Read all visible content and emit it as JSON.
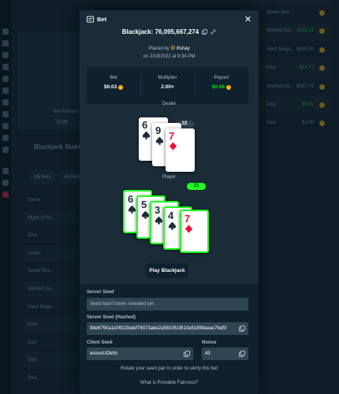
{
  "background": {
    "bet_amount_label": "Bet Amount",
    "bet_amount_value": "0.00",
    "game_title": "Blackjack  Stake Originals",
    "tabs": [
      "My Bets",
      "All Bets"
    ],
    "list_header": "Game",
    "list_rows": [
      "Might of Ra",
      "Dice",
      "Limbo",
      "Sweet Bon...",
      "Wanted De...",
      "Starz Mega...",
      "Dice",
      "Dice",
      "Dice",
      "Dice"
    ],
    "right_rows": [
      {
        "game": "Sweet Bon...",
        "amount": "",
        "green": false
      },
      {
        "game": "Wanted De...",
        "amount": "$131.11",
        "green": true
      },
      {
        "game": "Starz Mega...",
        "amount": "$400.00",
        "green": false
      },
      {
        "game": "Dice",
        "amount": "$14.77",
        "green": true
      },
      {
        "game": "Wanted De...",
        "amount": "$557.76",
        "green": false
      },
      {
        "game": "Dice",
        "amount": "$0.00",
        "green": true
      },
      {
        "game": "Dice",
        "amount": "$1.00",
        "green": false
      }
    ]
  },
  "modal": {
    "title": "Bet",
    "game_id": "Blackjack: 76,095,667,274",
    "placed_by_prefix": "Placed by",
    "username": "Bshay",
    "date": "on 2/19/2022 at 9:34 PM",
    "stats": [
      {
        "label": "Bet",
        "value": "$0.03",
        "coin": true,
        "green": false
      },
      {
        "label": "Multiplier",
        "value": "2.00×",
        "coin": false,
        "green": false
      },
      {
        "label": "Payout",
        "value": "$0.06",
        "coin": true,
        "green": true
      }
    ],
    "dealer": {
      "label": "Dealer",
      "score": "22",
      "cards": [
        {
          "rank": "6",
          "suit": "spade"
        },
        {
          "rank": "9",
          "suit": "spade"
        },
        {
          "rank": "7",
          "suit": "diamond"
        }
      ]
    },
    "player": {
      "label": "Player",
      "score": "21",
      "cards": [
        {
          "rank": "6",
          "suit": "spade"
        },
        {
          "rank": "5",
          "suit": "spade"
        },
        {
          "rank": "3",
          "suit": "spade"
        },
        {
          "rank": "4",
          "suit": "spade"
        },
        {
          "rank": "7",
          "suit": "diamond"
        }
      ]
    },
    "play_button": "Play Blackjack",
    "fairness": {
      "server_seed_label": "Server Seed",
      "server_seed_placeholder": "Seed hasn't been revealed yet",
      "server_seed_hashed_label": "Server Seed (Hashed)",
      "server_seed_hashed": "88e6750a1e091f2bdef76073abe2a581051f810a51899aeac7be5f",
      "client_seed_label": "Client Seed",
      "client_seed": "wssvsUOkhh",
      "nonce_label": "Nonce",
      "nonce": "43",
      "rotate_note": "Rotate your seed pair in order to verify this bet",
      "provable_link": "What is Provable Fairness?"
    }
  },
  "colors": {
    "modal_bg": "#1a2c38",
    "panel_bg": "#0f212e",
    "win_green": "#1fff20",
    "payout_green": "#00e701",
    "card_red": "#e9113c"
  }
}
